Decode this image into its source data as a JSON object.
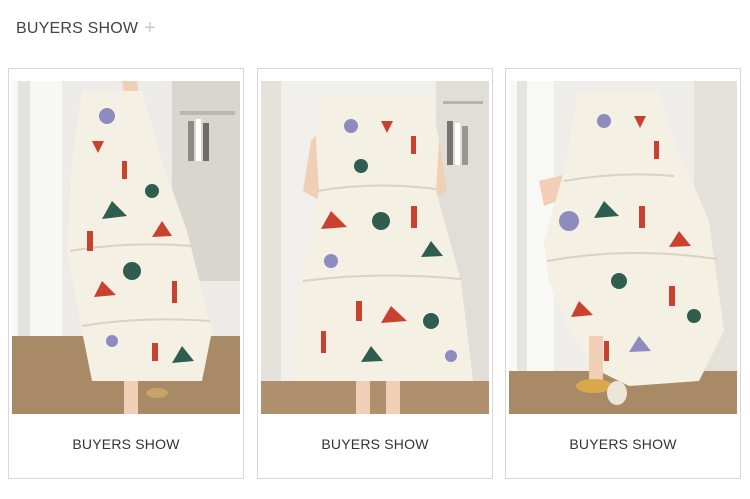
{
  "header": {
    "title": "BUYERS SHOW",
    "plus": "+"
  },
  "cards": [
    {
      "caption": "BUYERS SHOW",
      "photo_subject": "model in white patterned tiered midi dress, side view"
    },
    {
      "caption": "BUYERS SHOW",
      "photo_subject": "model in white patterned tiered midi dress, front view"
    },
    {
      "caption": "BUYERS SHOW",
      "photo_subject": "model seated holding skirt of white patterned dress, yellow flats"
    }
  ],
  "colors": {
    "header_text": "#444444",
    "plus": "#c8c8c8",
    "border": "#d7d7d7",
    "dress_base": "#f4f0e4",
    "print_red": "#c8422f",
    "print_green": "#2f5e50",
    "print_lavender": "#8e8bbf",
    "floor": "#a98a66"
  }
}
